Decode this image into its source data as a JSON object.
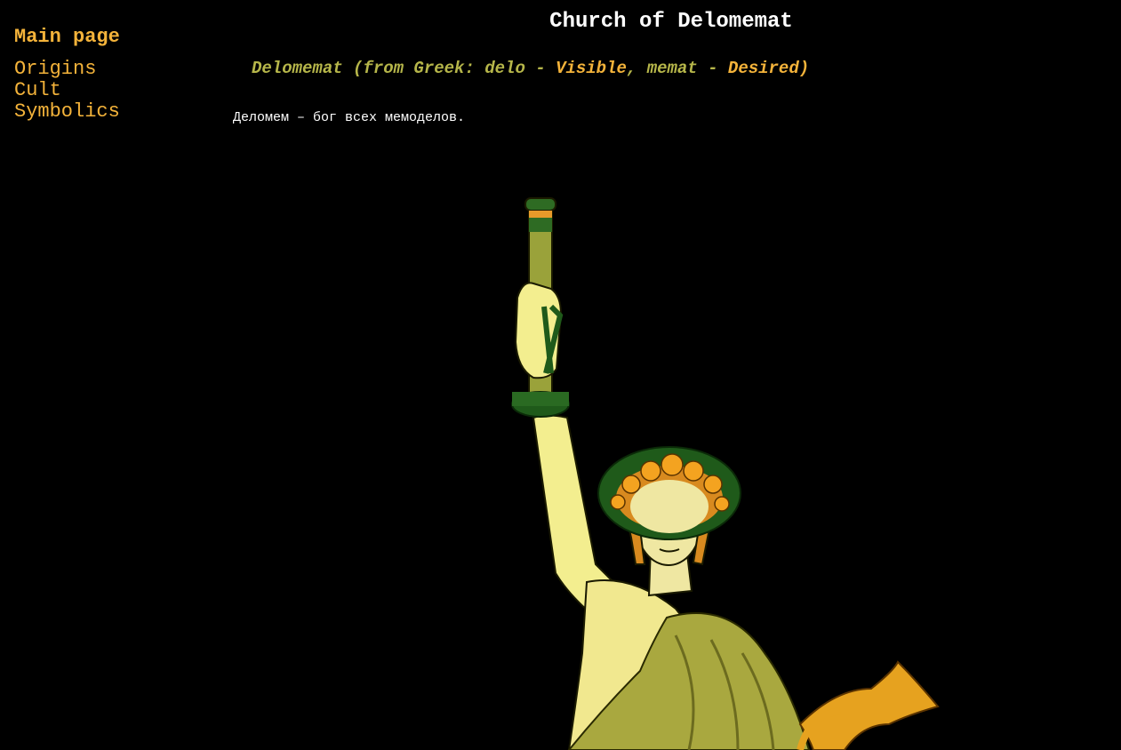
{
  "sidebar": {
    "main_page": "Main page",
    "items": [
      {
        "label": "Origins"
      },
      {
        "label": "Cult"
      },
      {
        "label": "Symbolics"
      }
    ]
  },
  "header": {
    "title": "Church of Delomemat"
  },
  "subtitle": {
    "part1": "Delomemat (from Greek: delo - ",
    "part2": "Visible",
    "part3": ", memat - ",
    "part4": "Desired)"
  },
  "content": {
    "text": "Деломем – бог всех мемоделов."
  },
  "colors": {
    "background": "#000000",
    "accent": "#f4b33a",
    "olive": "#b6b64a",
    "text": "#ffffff"
  },
  "icons": {
    "hero_image": "statue-illustration"
  }
}
